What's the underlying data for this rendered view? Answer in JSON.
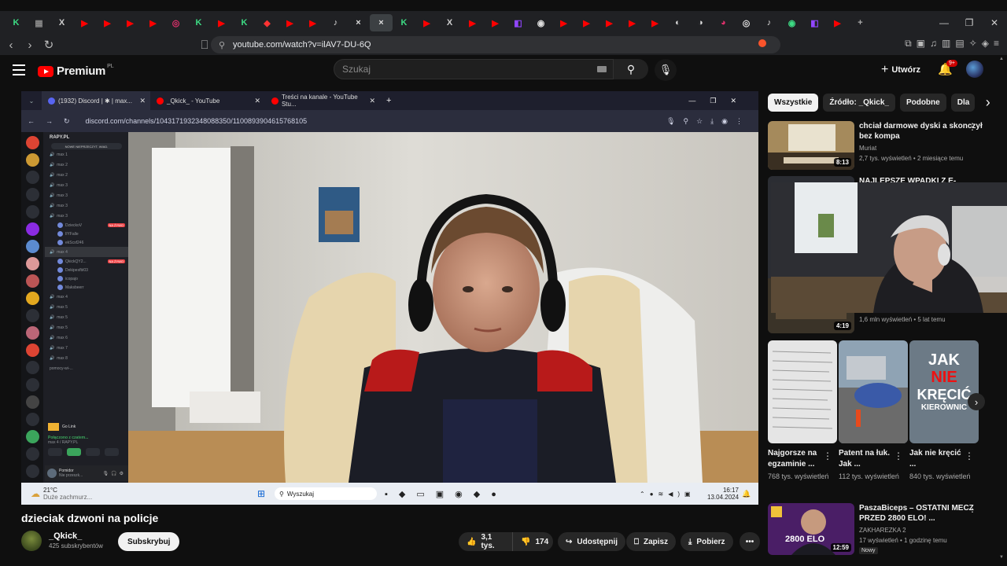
{
  "browser": {
    "tabs": [
      "K",
      "▦",
      "X",
      "▶",
      "▶",
      "▶",
      "▶",
      "◎",
      "K",
      "▶",
      "K",
      "◆",
      "▶",
      "▶",
      "♪",
      "×",
      "♪",
      "K",
      "▶",
      "X",
      "▶",
      "▶",
      "◧",
      "◉",
      "▶",
      "▶",
      "▶",
      "▶",
      "▶",
      "◐",
      "◑",
      "◕",
      "◎",
      "♪",
      "◉",
      "◧",
      "▶",
      "+"
    ],
    "active_tab_close": "×",
    "url": "youtube.com/watch?v=ilAV7-DU-6Q",
    "window_controls": [
      "—",
      "❐",
      "✕"
    ],
    "nav": [
      "‹",
      "›",
      "↻"
    ]
  },
  "youtube": {
    "logo_text": "Premium",
    "logo_region": "PL",
    "search_placeholder": "Szukaj",
    "create_label": "Utwórz",
    "notifications_badge": "9+"
  },
  "player": {
    "tabs": [
      {
        "label": "(1932) Discord | ✱ | max...",
        "color": "#5865f2"
      },
      {
        "label": "_Qkick_ - YouTube",
        "color": "#ff0000"
      },
      {
        "label": "Treści na kanale - YouTube Stu...",
        "color": "#ff0000"
      }
    ],
    "inner_url": "discord.com/channels/1043171932348088350/1100893904615768105",
    "server_name": "RAPY.PL",
    "unread_banner": "NOWE NIEPRZECZYT. WIAD.",
    "channels": [
      "max 1",
      "max 2",
      "max 2",
      "max 3",
      "max 3",
      "max 3",
      "max 3",
      "max 4",
      "max 4",
      "max 5",
      "max 5",
      "max 5",
      "max 6",
      "max 7",
      "max 8"
    ],
    "users": [
      "DzieckoV",
      "IlYFalle",
      "ekScsf246",
      "QkickQY2...",
      "Dekipesfbl03",
      "icopajo",
      "Maksbeerr"
    ],
    "live_tag": "NA ŻYWO",
    "help_channel": "pomocy-wi-...",
    "golink": "Go Link",
    "connected": "Połączono z czatem...",
    "connected_sub": "max 4 / RAPY.PL",
    "user_name": "Pomidor",
    "user_status": "Nie przeszk...",
    "taskbar": {
      "weather_temp": "21°C",
      "weather_desc": "Duże zachmurz...",
      "search": "Wyszukaj",
      "time": "16:17",
      "date": "13.04.2024"
    }
  },
  "video": {
    "title": "dzieciak dzwoni na policje",
    "channel": "_Qkick_",
    "subscribers": "425 subskrybentów",
    "subscribe_label": "Subskrybuj",
    "likes": "3,1 tys.",
    "dislikes": "174",
    "share": "Udostępnij",
    "save": "Zapisz",
    "download": "Pobierz",
    "more": "•••"
  },
  "sidebar": {
    "chips": [
      "Wszystkie",
      "Źródło: _Qkick_",
      "Podobne",
      "Dla"
    ],
    "next_arrow": "›",
    "videos": [
      {
        "title": "chciał darmowe dyski a skonczył bez kompa",
        "channel": "Muriat",
        "meta": "2,7 tys. wyświetleń • 2 miesiące temu",
        "duration": "8:13"
      },
      {
        "title": "NAJLEPSZE WPADKI Z E-",
        "channel": "",
        "meta": "1,6 mln wyświetleń • 5 lat temu",
        "duration": "4:19"
      },
      {
        "title": "PaszaBiceps – OSTATNI MECZ PRZED 2800 ELO! ...",
        "channel": "ZAKHAREZKA 2",
        "meta": "17 wyświetleń • 1 godzinę temu",
        "duration": "12:59",
        "badge": "Nowy",
        "thumb_text": "2800 ELO"
      }
    ],
    "shorts": [
      {
        "title": "Najgorsze na egzaminie ...",
        "views": "768 tys. wyświetleń"
      },
      {
        "title": "Patent na łuk. Jak ...",
        "views": "112 tys. wyświetleń"
      },
      {
        "title": "Jak nie kręcić ...",
        "views": "840 tys. wyświetleń",
        "overlay": [
          "JAK",
          "NIE",
          "KRĘCIĆ",
          "KIEROWNIC"
        ]
      }
    ]
  }
}
